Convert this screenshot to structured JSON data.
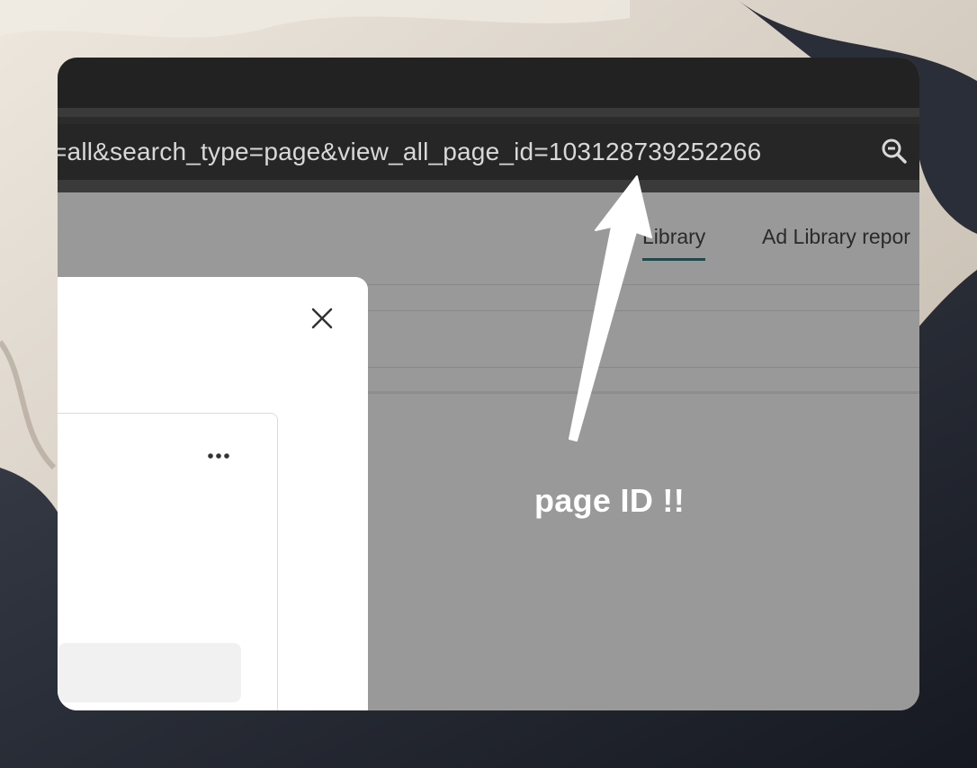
{
  "browser": {
    "url_fragment": "=all&search_type=page&view_all_page_id=103128739252266",
    "search_icon": "zoom-search-icon"
  },
  "page": {
    "tabs": [
      {
        "label": "Library",
        "active": true
      },
      {
        "label": "Ad Library repor",
        "active": false
      }
    ]
  },
  "modal": {
    "close_icon": "close-icon",
    "more_icon": "more-horizontal-icon"
  },
  "annotation": {
    "text": "page ID !!",
    "color": "#ffffff"
  },
  "colors": {
    "titlebar": "#222222",
    "urlbar": "#262626",
    "page_dimmed": "#999999",
    "active_tab_underline": "#1f4a4a",
    "modal_bg": "#ffffff"
  }
}
